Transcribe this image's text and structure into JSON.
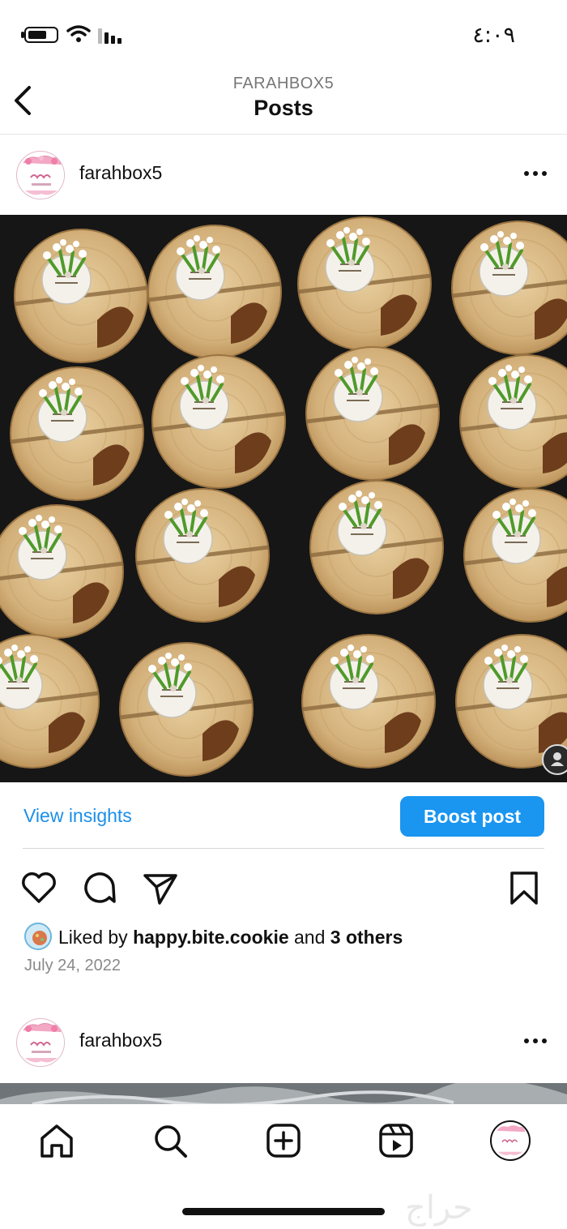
{
  "status_bar": {
    "time": "٤:٠٩"
  },
  "header": {
    "account": "FARAHBOX5",
    "title": "Posts"
  },
  "post": {
    "username": "farahbox5",
    "insights_label": "View insights",
    "boost_label": "Boost post",
    "liked_prefix": "Liked by",
    "liked_user": "happy.bite.cookie",
    "liked_and": "and",
    "liked_others": "3 others",
    "date": "July 24, 2022"
  },
  "next_post": {
    "username": "farahbox5"
  },
  "watermark": "حراج",
  "icons": {
    "back": "chevron-left-icon",
    "more": "more-horizontal-icon",
    "like": "heart-icon",
    "comment": "comment-icon",
    "share": "send-icon",
    "save": "bookmark-icon",
    "home": "home-icon",
    "search": "search-icon",
    "create": "plus-square-icon",
    "reels": "reels-icon"
  },
  "colors": {
    "accent": "#1a95f0",
    "link": "#1b8fea",
    "text": "#111111",
    "muted": "#8a8a8a"
  }
}
